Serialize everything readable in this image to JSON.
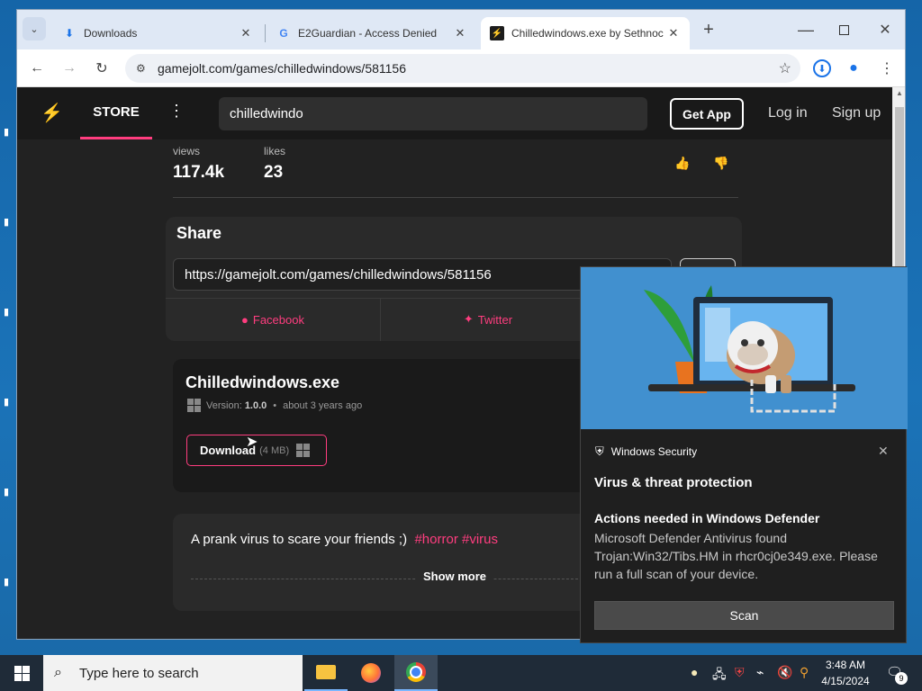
{
  "browser": {
    "tabs": [
      {
        "label": "Downloads",
        "icon": "download-icon"
      },
      {
        "label": "E2Guardian - Access Denied",
        "icon": "google-icon"
      },
      {
        "label": "Chilledwindows.exe by Sethnoc",
        "icon": "gamejolt-icon"
      }
    ],
    "url": "gamejolt.com/games/chilledwindows/581156"
  },
  "gamejolt": {
    "nav": {
      "store": "STORE",
      "search_value": "chilledwindo",
      "get_app": "Get App",
      "login": "Log in",
      "signup": "Sign up"
    },
    "stats": {
      "views_label": "views",
      "views_value": "117.4k",
      "likes_label": "likes",
      "likes_value": "23"
    },
    "share": {
      "title": "Share",
      "link": "https://gamejolt.com/games/chilledwindows/581156",
      "copy": "Copy",
      "facebook": "Facebook",
      "twitter": "Twitter"
    },
    "build": {
      "name": "Chilledwindows.exe",
      "version_label": "Version:",
      "version": "1.0.0",
      "date": "about 3 years ago",
      "download": "Download",
      "size": "(4 MB)"
    },
    "description": {
      "text": "A prank virus to scare your friends ;)",
      "tags": "#horror #virus",
      "show_more": "Show more"
    }
  },
  "notification": {
    "app": "Windows Security",
    "heading": "Virus & threat protection",
    "title": "Actions needed in Windows Defender",
    "body": "Microsoft Defender Antivirus found Trojan:Win32/Tibs.HM in rhcr0cj0e349.exe.  Please run a full scan of your device.",
    "button": "Scan"
  },
  "taskbar": {
    "search_placeholder": "Type here to search",
    "time": "3:48 AM",
    "date": "4/15/2024",
    "notifications": "9"
  },
  "colors": {
    "accent": "#ff3d7f",
    "page_bg": "#222222",
    "taskbar": "#1f2b38"
  }
}
